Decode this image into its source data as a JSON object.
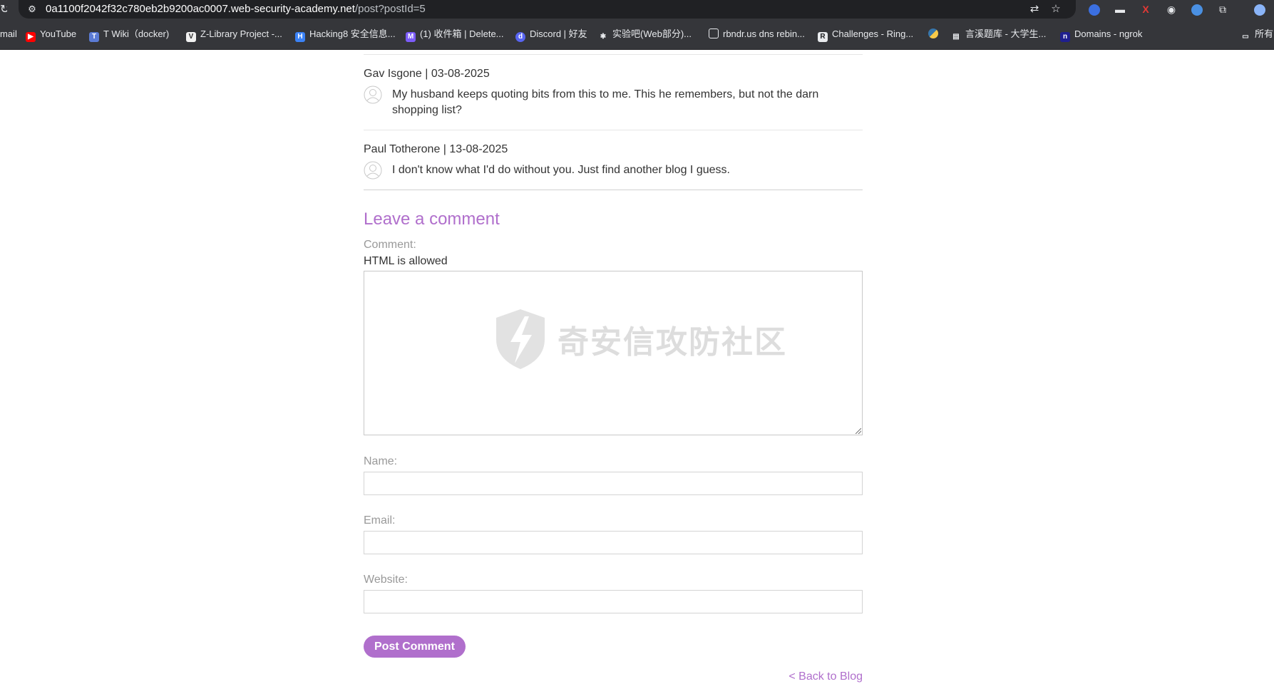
{
  "browser": {
    "url_host": "0a1100f2042f32c780eb2b9200ac0007.web-security-academy.net",
    "url_path": "/post?postId=5",
    "bookmarks": [
      {
        "label": "mail",
        "icon": "mail-icon",
        "color": "#35363a"
      },
      {
        "label": "YouTube",
        "icon": "youtube-icon",
        "color": "#ff0000"
      },
      {
        "label": "T Wiki（docker)",
        "icon": "wiki-icon",
        "color": "#5b7bd5"
      },
      {
        "label": "Z-Library Project -...",
        "icon": "zlibrary-icon",
        "color": "#f1f1f1"
      },
      {
        "label": "Hacking8 安全信息...",
        "icon": "hacking8-icon",
        "color": "#3b82f6"
      },
      {
        "label": "(1) 收件箱 | Delete...",
        "icon": "proton-mail-icon",
        "color": "#7c5cfa"
      },
      {
        "label": "Discord | 好友",
        "icon": "discord-icon",
        "color": "#5865f2"
      },
      {
        "label": "实验吧(Web部分)...",
        "icon": "gear-icon",
        "color": "#e8eaed"
      },
      {
        "label": "rbndr.us dns rebin...",
        "icon": "page-icon",
        "color": "#e8eaed"
      },
      {
        "label": "Challenges - Ring...",
        "icon": "ring-icon",
        "color": "#e8eaed"
      },
      {
        "label": "",
        "icon": "python-icon",
        "color": "#f7c948"
      },
      {
        "label": "言溪题库 - 大学生...",
        "icon": "book-icon",
        "color": "#e8eaed"
      },
      {
        "label": "Domains - ngrok",
        "icon": "ngrok-icon",
        "color": "#1f1f8f"
      },
      {
        "label": "所有",
        "icon": "folder-icon",
        "color": "#e8eaed"
      }
    ]
  },
  "comments": [
    {
      "author": "Gav Isgone",
      "date": "03-08-2025",
      "text": "My husband keeps quoting bits from this to me. This he remembers, but not the darn shopping list?"
    },
    {
      "author": "Paul Totherone",
      "date": "13-08-2025",
      "text": "I don't know what I'd do without you. Just find another blog I guess."
    }
  ],
  "form": {
    "title": "Leave a comment",
    "comment_label": "Comment:",
    "html_note": "HTML is allowed",
    "name_label": "Name:",
    "email_label": "Email:",
    "website_label": "Website:",
    "submit_label": "Post Comment",
    "comment_value": "",
    "name_value": "",
    "email_value": "",
    "website_value": ""
  },
  "back_link": "< Back to Blog",
  "watermark": {
    "text": "奇安信攻防社区"
  },
  "colors": {
    "accent": "#b06fcc",
    "chrome": "#35363a",
    "omnibox": "#202124"
  }
}
